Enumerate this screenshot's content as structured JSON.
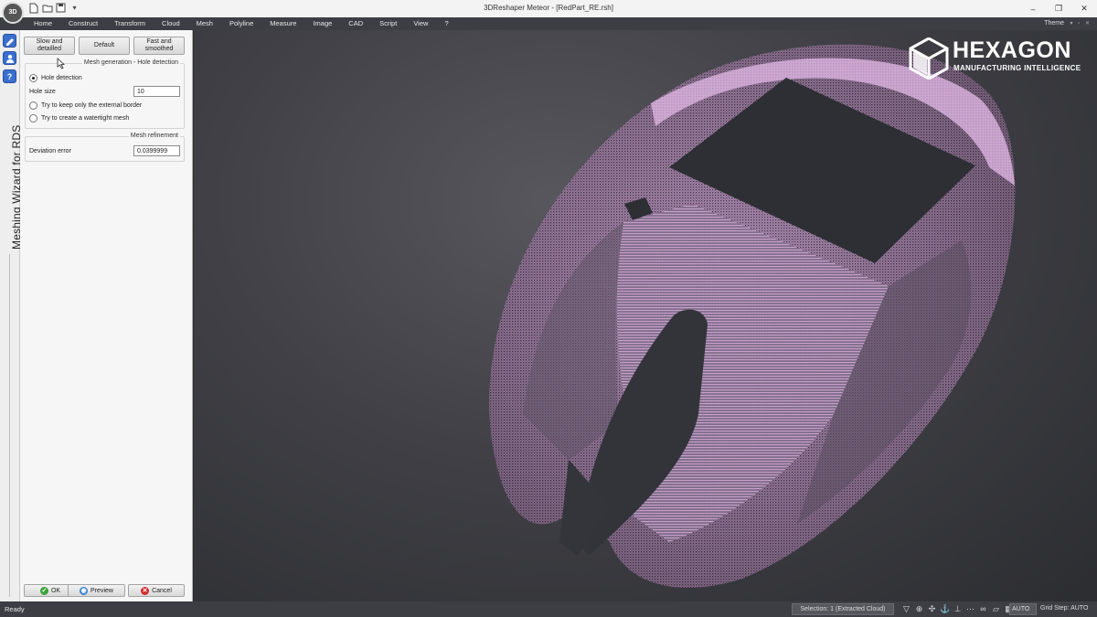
{
  "app": {
    "logo_text": "3D",
    "window_title": "3DReshaper Meteor - [RedPart_RE.rsh]",
    "window_controls": [
      "–",
      "❐",
      "✕"
    ]
  },
  "quick_access": {
    "icons": [
      "new-file-icon",
      "open-folder-icon",
      "save-icon"
    ],
    "dropdown": "▾"
  },
  "menu": {
    "items": [
      "Home",
      "Construct",
      "Transform",
      "Cloud",
      "Mesh",
      "Polyline",
      "Measure",
      "Image",
      "CAD",
      "Script",
      "View",
      "?"
    ],
    "theme_label": "Theme",
    "theme_controls": "▾ ▫ ✕"
  },
  "left_strip": {
    "icons": [
      "wizard-icon",
      "user-icon",
      "help-icon"
    ],
    "help_glyph": "?",
    "title": "Meshing Wizard for RDS"
  },
  "panel": {
    "presets": {
      "slow": "Slow and detailled",
      "default": "Default",
      "fast": "Fast and smoothed"
    },
    "mesh_generation": {
      "title": "Mesh generation - Hole detection",
      "hole_detection_label": "Hole detection",
      "hole_detection_selected": true,
      "hole_size_label": "Hole size",
      "hole_size_value": "10",
      "external_border_label": "Try to keep only the external border",
      "watertight_label": "Try to create a watertight mesh"
    },
    "mesh_refinement": {
      "title": "Mesh refinement",
      "deviation_label": "Deviation error",
      "deviation_value": "0.0399999"
    },
    "buttons": {
      "ok": "OK",
      "preview": "Preview",
      "cancel": "Cancel"
    }
  },
  "viewport": {
    "brand": "HEXAGON",
    "brand_sub": "MANUFACTURING INTELLIGENCE",
    "cloud_color": "#d9a8dc"
  },
  "statusbar": {
    "status": "Ready",
    "selection": "Selection: 1 (Extracted Cloud)",
    "auto": "AUTO",
    "grid_step": "Grid Step: AUTO"
  },
  "colors": {
    "menubar": "#3c3e44",
    "viewport_bg": "#404046",
    "accent_blue": "#3a6fcf",
    "ok_green": "#3ca33c",
    "cancel_red": "#cc2b2b"
  }
}
